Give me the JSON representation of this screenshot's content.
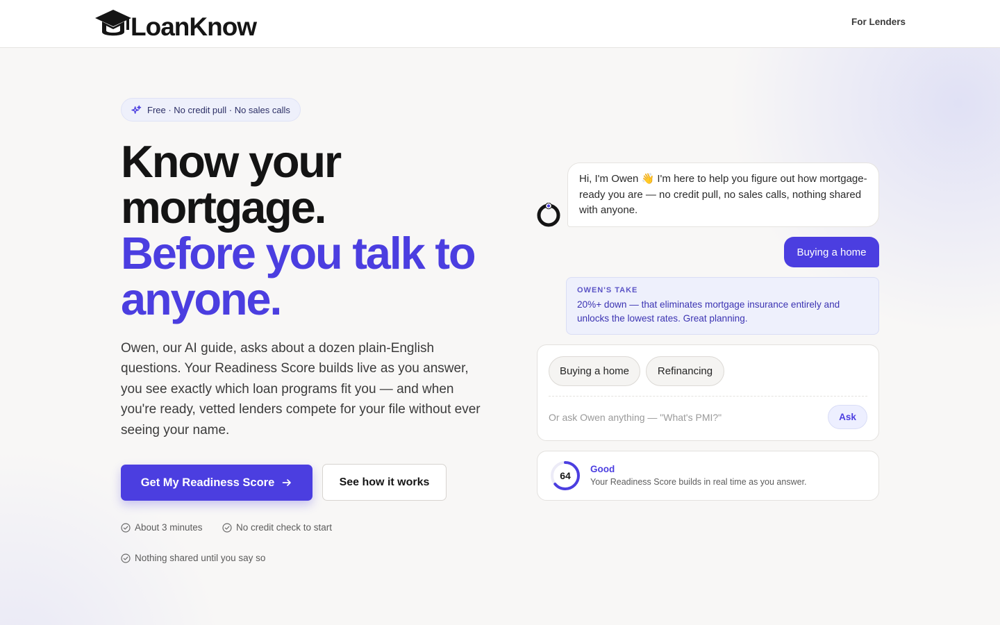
{
  "header": {
    "brand": "LoanKnow",
    "nav_link": "For Lenders"
  },
  "hero": {
    "badge": "Free · No credit pull · No sales calls",
    "headline_line1": "Know your",
    "headline_line2": "mortgage.",
    "headline_accent1": "Before you talk to",
    "headline_accent2": "anyone.",
    "lead": "Owen, our AI guide, asks about a dozen plain-English questions. Your Readiness Score builds live as you answer, you see exactly which loan programs fit you — and when you're ready, vetted lenders compete for your file without ever seeing your name.",
    "primary_cta": "Get My Readiness Score",
    "secondary_cta": "See how it works",
    "checks": [
      "About 3 minutes",
      "No credit check to start",
      "Nothing shared until you say so"
    ]
  },
  "chat": {
    "bot_message": "Hi, I'm Owen 👋 I'm here to help you figure out how mortgage-ready you are — no credit pull, no sales calls, nothing shared with anyone.",
    "user_message": "Buying a home",
    "take_title": "OWEN'S TAKE",
    "take_body": "20%+ down — that eliminates mortgage insurance entirely and unlocks the lowest rates. Great planning.",
    "options": [
      "Buying a home",
      "Refinancing"
    ],
    "ask_placeholder": "Or ask Owen anything — \"What's PMI?\"",
    "ask_button": "Ask"
  },
  "score": {
    "value": "64",
    "fraction": 0.64,
    "label": "Good",
    "description": "Your Readiness Score builds in real time as you answer."
  },
  "colors": {
    "accent": "#4b3ee0",
    "background": "#f8f7f6",
    "take_background": "#eef0fc"
  },
  "icons": {
    "logo": "graduation-cap-icon",
    "badge": "sparkles-icon",
    "cta": "arrow-right-icon",
    "check": "check-circle-icon",
    "avatar": "owen-ring-avatar"
  }
}
